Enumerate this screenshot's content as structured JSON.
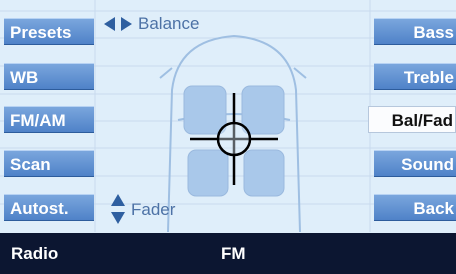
{
  "left_buttons": [
    "Presets",
    "WB",
    "FM/AM",
    "Scan",
    "Autost."
  ],
  "right_buttons": [
    "Bass",
    "Treble",
    "Bal/Fad",
    "Sound",
    "Back"
  ],
  "selected_right": 2,
  "labels": {
    "balance": "Balance",
    "fader": "Fader"
  },
  "footer": {
    "source": "Radio",
    "band": "FM"
  },
  "colors": {
    "background": "#dfeefa",
    "button": "#5b8ed0",
    "footer": "#0c1631",
    "text_label": "#4d72a6"
  }
}
